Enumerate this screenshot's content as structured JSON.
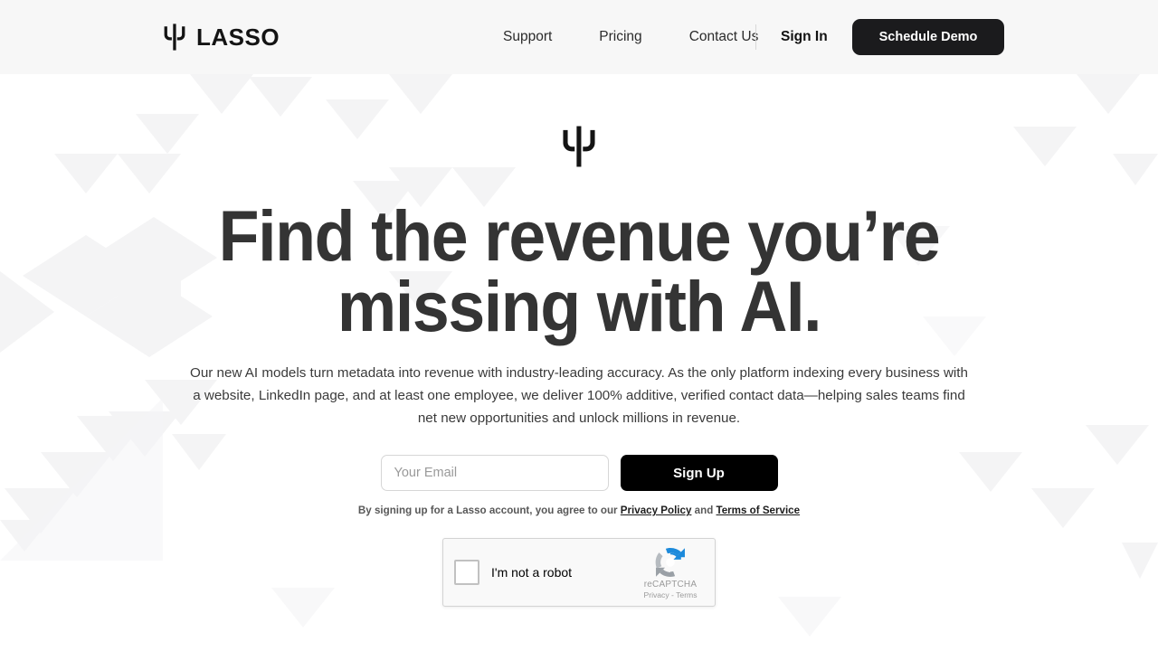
{
  "header": {
    "brand_name": "LASSO",
    "brand_mark_icon": "lasso-trident-icon",
    "nav": [
      {
        "label": "Support"
      },
      {
        "label": "Pricing"
      },
      {
        "label": "Contact Us"
      }
    ],
    "sign_in_label": "Sign In",
    "schedule_demo_label": "Schedule Demo",
    "background_color": "#f7f7f7",
    "button_color": "#1b1b1d"
  },
  "hero": {
    "mark_icon": "lasso-trident-icon",
    "headline_line1": "Find the revenue you’re",
    "headline_line2": "missing with AI.",
    "headline_color": "#343434",
    "subcopy": "Our new AI models turn metadata into revenue with industry-leading accuracy. As the only platform indexing every business with a website, LinkedIn page, and at least one employee, we deliver 100% additive, verified contact data—helping sales teams find net new opportunities and unlock millions in revenue."
  },
  "signup": {
    "email_placeholder": "Your Email",
    "email_value": "",
    "button_label": "Sign Up",
    "button_color": "#000000"
  },
  "legal": {
    "prefix": "By signing up for a Lasso account, you agree to our ",
    "privacy_link": "Privacy Policy",
    "conjunction": " and ",
    "terms_link": "Terms of Service"
  },
  "recaptcha": {
    "label": "I'm not a robot",
    "brand_name": "reCAPTCHA",
    "links": "Privacy - Terms",
    "logo_icon": "recaptcha-logo-icon",
    "checkbox_checked": false
  },
  "background": {
    "pattern_color": "#f4f4f5",
    "page_color": "#ffffff"
  }
}
